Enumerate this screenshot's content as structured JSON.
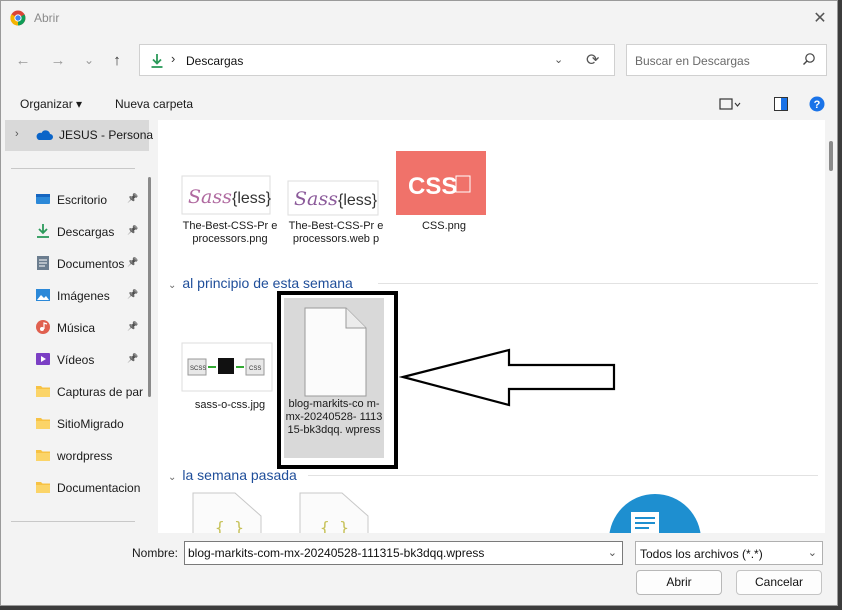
{
  "window": {
    "title": "Abrir",
    "close_glyph": "✕"
  },
  "nav": {
    "back_glyph": "←",
    "forward_glyph": "→",
    "recent_glyph": "⌄",
    "up_glyph": "↑",
    "address_sep": "›",
    "address_path": "Descargas",
    "address_dropdown_glyph": "⌄",
    "refresh_glyph": "⟳"
  },
  "search": {
    "placeholder": "Buscar en Descargas"
  },
  "toolbar": {
    "organize_label": "Organizar ▾",
    "new_folder_label": "Nueva carpeta"
  },
  "sidebar": {
    "top": {
      "chevron": "›",
      "label": "JESUS - Persona"
    },
    "pin_glyph": "📌",
    "items": [
      {
        "label": "Escritorio",
        "icon": "desktop-icon",
        "pinned": true
      },
      {
        "label": "Descargas",
        "icon": "download-icon",
        "pinned": true
      },
      {
        "label": "Documentos",
        "icon": "documents-icon",
        "pinned": true
      },
      {
        "label": "Imágenes",
        "icon": "pictures-icon",
        "pinned": true
      },
      {
        "label": "Música",
        "icon": "music-icon",
        "pinned": true
      },
      {
        "label": "Vídeos",
        "icon": "videos-icon",
        "pinned": true
      },
      {
        "label": "Capturas de par",
        "icon": "folder-icon",
        "pinned": false
      },
      {
        "label": "SitioMigrado",
        "icon": "folder-icon",
        "pinned": false
      },
      {
        "label": "wordpress",
        "icon": "folder-icon",
        "pinned": false
      },
      {
        "label": "Documentacion",
        "icon": "folder-icon",
        "pinned": false
      }
    ]
  },
  "content": {
    "top_files": [
      {
        "name": "The-Best-CSS-Preprocessors.png",
        "display": "The-Best-CSS-Pr eprocessors.png"
      },
      {
        "name": "The-Best-CSS-Preprocessors.webp",
        "display": "The-Best-CSS-Pr eprocessors.web p"
      },
      {
        "name": "CSS.png",
        "display": "CSS.png"
      }
    ],
    "groups": [
      {
        "header": "al principio de esta semana",
        "chevron": "⌄",
        "files": [
          {
            "name": "sass-o-css.jpg",
            "display": "sass-o-css.jpg"
          },
          {
            "name": "blog-markits-com-mx-20240528-111315-bk3dqq.wpress",
            "display": "blog-markits-co m-mx-20240528- 111315-bk3dqq. wpress",
            "selected": true
          }
        ]
      },
      {
        "header": "la semana pasada",
        "chevron": "⌄"
      }
    ],
    "thumb_text": {
      "sass": "Sass",
      "less": "{less}",
      "css": "CSS",
      "scss_label": "SCSS",
      "css_label": "CSS"
    }
  },
  "footer": {
    "name_label": "Nombre:",
    "name_value": "blog-markits-com-mx-20240528-111315-bk3dqq.wpress",
    "name_dropdown_glyph": "⌄",
    "type_value": "Todos los archivos (*.*)",
    "type_dropdown_glyph": "⌄",
    "open_label": "Abrir",
    "cancel_label": "Cancelar"
  },
  "colors": {
    "accent": "#0067c0",
    "group_header": "#1f4e9a",
    "css_thumb": "#f0726a",
    "sass_purple": "#8b5a9a",
    "help_blue": "#1a73e8"
  }
}
